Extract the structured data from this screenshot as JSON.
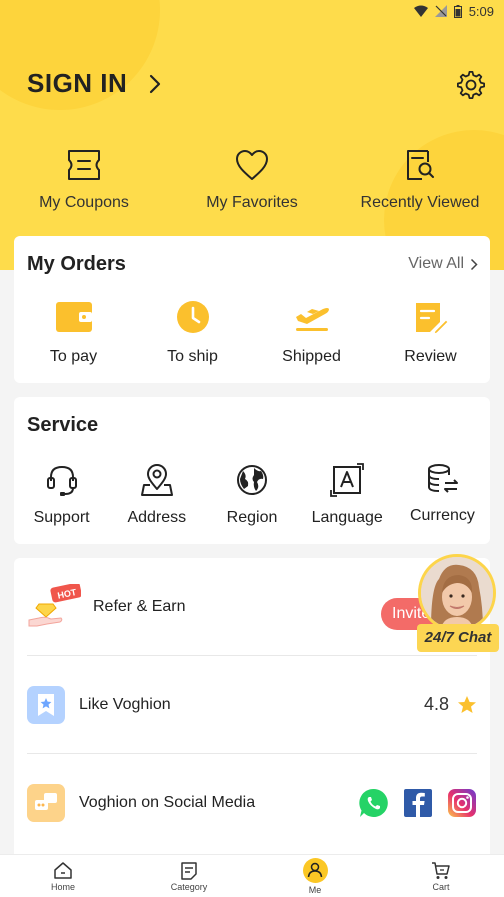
{
  "status_bar": {
    "time": "5:09"
  },
  "header": {
    "sign_in_label": "SIGN IN"
  },
  "quick_links": [
    {
      "label": "My Coupons",
      "icon": "ticket-icon"
    },
    {
      "label": "My Favorites",
      "icon": "heart-icon"
    },
    {
      "label": "Recently Viewed",
      "icon": "history-icon"
    }
  ],
  "orders": {
    "title": "My Orders",
    "view_all": "View All",
    "items": [
      {
        "label": "To pay",
        "icon": "wallet-icon"
      },
      {
        "label": "To ship",
        "icon": "clock-icon"
      },
      {
        "label": "Shipped",
        "icon": "plane-icon"
      },
      {
        "label": "Review",
        "icon": "review-icon"
      }
    ]
  },
  "service": {
    "title": "Service",
    "items": [
      {
        "label": "Support",
        "icon": "headset-icon"
      },
      {
        "label": "Address",
        "icon": "location-icon"
      },
      {
        "label": "Region",
        "icon": "globe-icon"
      },
      {
        "label": "Language",
        "icon": "language-icon"
      },
      {
        "label": "Currency",
        "icon": "currency-icon"
      }
    ]
  },
  "list": {
    "refer": {
      "label": "Refer & Earn",
      "hot_badge": "HOT",
      "button": "Invite"
    },
    "like": {
      "label": "Like Voghion",
      "rating": "4.8"
    },
    "social": {
      "label": "Voghion on Social Media"
    }
  },
  "chat": {
    "label": "24/7 Chat"
  },
  "bottom_nav": [
    {
      "label": "Home",
      "icon": "home-icon"
    },
    {
      "label": "Category",
      "icon": "category-icon"
    },
    {
      "label": "Me",
      "icon": "me-icon",
      "active": true
    },
    {
      "label": "Cart",
      "icon": "cart-icon"
    }
  ],
  "colors": {
    "header_yellow": "#fedc4b",
    "icon_yellow": "#fbc02d",
    "invite_red": "#f36b68",
    "whatsapp_green": "#25d366",
    "facebook_blue": "#1877f2"
  }
}
